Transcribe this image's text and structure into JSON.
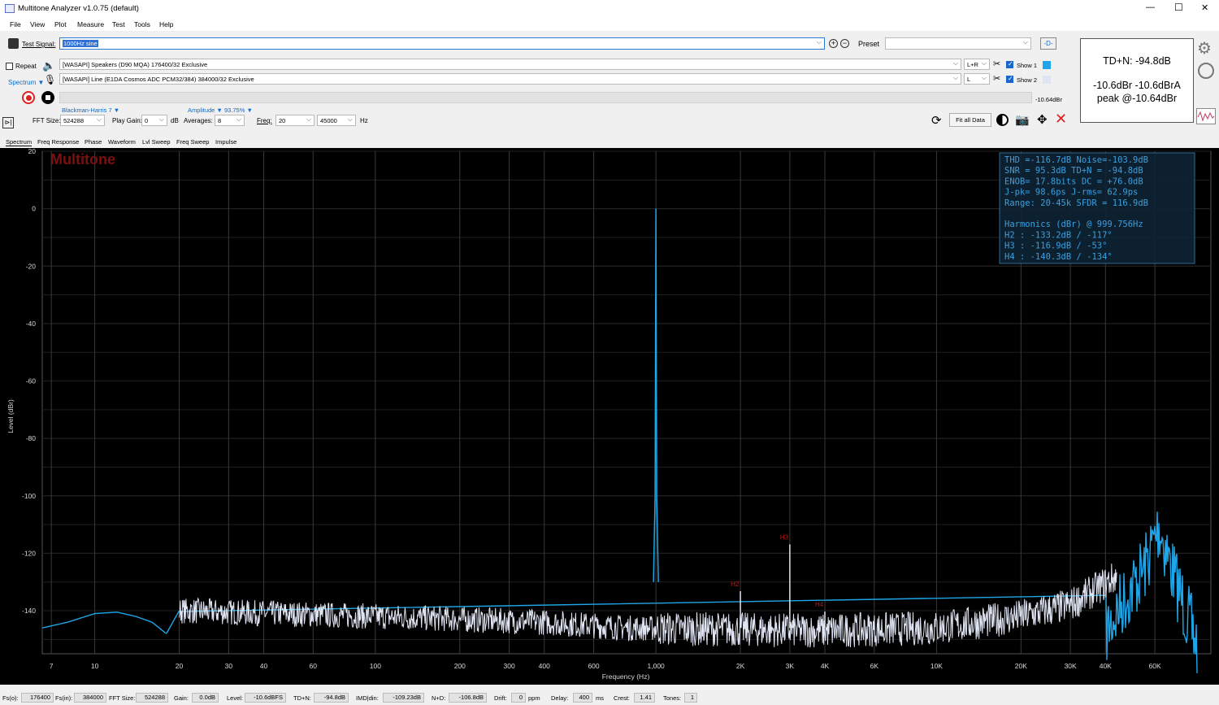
{
  "window": {
    "title": "Multitone Analyzer v1.0.75 (default)",
    "minimize": "—",
    "maximize": "☐",
    "close": "✕"
  },
  "menu": [
    "File",
    "View",
    "Plot",
    "Measure",
    "Test",
    "Tools",
    "Help"
  ],
  "test_signal": {
    "label": "Test Signal:",
    "value": "1000Hz sine",
    "preset_label": "Preset",
    "preset_value": ""
  },
  "repeat_label": "Repeat",
  "spectrum_label": "Spectrum ▼",
  "output_device": "[WASAPI] Speakers (D90 MQA) 176400/32 Exclusive",
  "input_device": "[WASAPI] Line (E1DA Cosmos ADC PCM32/384) 384000/32 Exclusive",
  "output_channel": "L+R",
  "input_channel": "L",
  "show1": "Show 1",
  "show2": "Show 2",
  "level_meter_text": "-10.64dBr",
  "window_fn": "Blackman-Harris 7 ▼",
  "amplitude_label": "Amplitude ▼ 93.75% ▼",
  "controls": {
    "fft_size_label": "FFT Size:",
    "fft_size": "524288",
    "play_gain_label": "Play Gain:",
    "play_gain": "0",
    "play_gain_unit": "dB",
    "averages_label": "Averages:",
    "averages": "8",
    "freq_label": "Freq:",
    "freq_from": "20",
    "freq_to": "45000",
    "freq_unit": "Hz",
    "fit_all": "Fit all Data"
  },
  "td_panel": {
    "line1": "TD+N: -94.8dB",
    "line2": "-10.6dBr  -10.6dBrA",
    "line3": "peak @-10.64dBr"
  },
  "tabs": [
    "Spectrum",
    "Freq Response",
    "Phase",
    "Waveform",
    "Lvl Sweep",
    "Freq Sweep",
    "Impulse"
  ],
  "plot": {
    "watermark": "Multitone",
    "ylabel": "Level (dBr)",
    "xlabel": "Frequency (Hz)",
    "stats": [
      "THD =-116.7dB     Noise=-103.9dB",
      "SNR =  95.3dB     TD+N = -94.8dB",
      "ENOB=  17.8bits   DC   = +76.0dB",
      "J-pk=  98.6ps     J-rms=  62.9ps",
      "Range: 20-45k     SFDR = 116.9dB",
      "",
      "Harmonics (dBr) @ 999.756Hz",
      "H2 :  -133.2dB / -117°",
      "H3 :  -116.9dB /  -53°",
      "H4 :  -140.3dB / -134°"
    ]
  },
  "chart_data": {
    "type": "line",
    "xlabel": "Frequency (Hz)",
    "ylabel": "Level (dBr)",
    "x_scale": "log",
    "xlim": [
      6.5,
      95000
    ],
    "ylim": [
      -155,
      20
    ],
    "x_ticks": [
      7,
      10,
      20,
      30,
      40,
      60,
      100,
      200,
      300,
      400,
      600,
      1000,
      2000,
      3000,
      4000,
      6000,
      10000,
      20000,
      30000,
      40000,
      60000
    ],
    "x_tick_labels": [
      "7",
      "10",
      "20",
      "30",
      "40",
      "60",
      "100",
      "200",
      "300",
      "400",
      "600",
      "1,000",
      "2K",
      "3K",
      "4K",
      "6K",
      "10K",
      "20K",
      "30K",
      "40K",
      "60K"
    ],
    "y_ticks": [
      20,
      0,
      -20,
      -40,
      -60,
      -80,
      -100,
      -120,
      -140
    ],
    "grid": true,
    "series": [
      {
        "color": "#1ea6e8",
        "points": [
          [
            6.5,
            -146
          ],
          [
            8,
            -144
          ],
          [
            10,
            -141
          ],
          [
            12,
            -140.5
          ],
          [
            14,
            -142
          ],
          [
            16,
            -144
          ],
          [
            18,
            -148
          ],
          [
            20,
            -140
          ],
          [
            30,
            -141
          ],
          [
            40000,
            -135
          ],
          [
            45000,
            -126
          ],
          [
            55000,
            -113
          ],
          [
            62000,
            -98
          ],
          [
            70000,
            -115
          ],
          [
            85000,
            -140
          ]
        ]
      },
      {
        "color": "#dfe4f2",
        "points": [
          [
            20,
            -140
          ],
          [
            100,
            -142
          ],
          [
            400,
            -144
          ],
          [
            999.76,
            -10.6
          ],
          [
            1000,
            0
          ],
          [
            2000,
            -145
          ],
          [
            4000,
            -147
          ],
          [
            10000,
            -146
          ],
          [
            20000,
            -142
          ],
          [
            30000,
            -138
          ],
          [
            44000,
            -128
          ]
        ]
      }
    ],
    "harmonics": [
      {
        "name": "H2",
        "freq": 2000,
        "level": -133.2
      },
      {
        "name": "H3",
        "freq": 3000,
        "level": -116.9
      },
      {
        "name": "H4",
        "freq": 4000,
        "level": -140.3
      }
    ],
    "fundamental": {
      "freq": 999.756,
      "level": 0
    }
  },
  "status": [
    {
      "label": "Fs(o):",
      "value": "176400"
    },
    {
      "label": "Fs(in):",
      "value": "384000"
    },
    {
      "label": "FFT Size:",
      "value": "524288"
    },
    {
      "label": "Gain:",
      "value": "0.0dB"
    },
    {
      "label": "Level:",
      "value": "-10.6dBFS"
    },
    {
      "label": "TD+N:",
      "value": "-94.8dB"
    },
    {
      "label": "IMD|din:",
      "value": "-109.23dB"
    },
    {
      "label": "N+D:",
      "value": "-106.8dB"
    },
    {
      "label": "Drift:",
      "value": "0",
      "unit": "ppm"
    },
    {
      "label": "Delay:",
      "value": "400",
      "unit": "ms"
    },
    {
      "label": "Crest:",
      "value": "1.41"
    },
    {
      "label": "Tones:",
      "value": "1"
    }
  ]
}
